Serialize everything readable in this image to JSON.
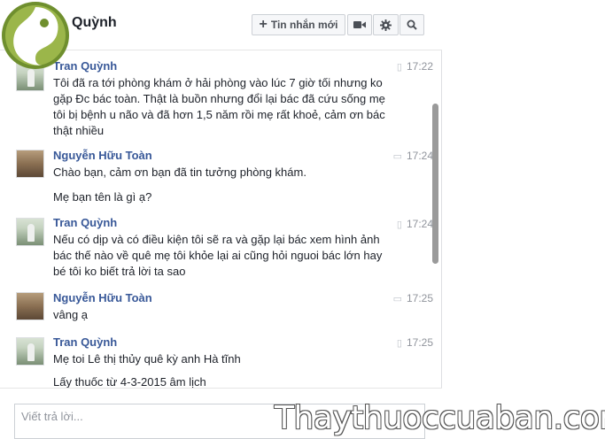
{
  "header": {
    "title": "Quỳnh",
    "new_message_label": "Tin nhắn mới",
    "video_icon": "video-camera-icon",
    "settings_icon": "gear-icon",
    "search_icon": "search-icon"
  },
  "messages": [
    {
      "sender": "Tran Quỳnh",
      "time": "17:22",
      "via": "mobile-phone-icon",
      "lines": [
        "Tôi đã ra tới phòng khám ở hải phòng vào lúc 7 giờ tối nhưng ko gặp Đc bác toàn. Thật là buồn nhưng đổi lại bác đã cứu sống mẹ tôi bị bệnh u não và đã hơn 1,5 năm rồi mẹ rất khoẻ, cảm ơn bác thật nhiều"
      ]
    },
    {
      "sender": "Nguyễn Hữu Toàn",
      "time": "17:24",
      "via": "chat-bubble-icon",
      "lines": [
        "Chào bạn, cảm ơn bạn đã tin tưởng phòng khám.",
        "Mẹ bạn tên là gì ạ?"
      ]
    },
    {
      "sender": "Tran Quỳnh",
      "time": "17:24",
      "via": "mobile-phone-icon",
      "lines": [
        "Nếu có dịp và có điều kiện tôi sẽ ra và gặp lại bác xem hình ảnh bác thế nào về quê mẹ tôi khỏe lại ai cũng hỏi nguoi bác lớn hay bé tôi ko biết trả lời ta sao"
      ]
    },
    {
      "sender": "Nguyễn Hữu Toàn",
      "time": "17:25",
      "via": "chat-bubble-icon",
      "lines": [
        "vâng ạ"
      ]
    },
    {
      "sender": "Tran Quỳnh",
      "time": "17:25",
      "via": "mobile-phone-icon",
      "lines": [
        "Mẹ toi Lê thị thủy quê kỳ anh Hà tĩnh",
        "Lấy thuốc từ 4-3-2015 âm lịch"
      ]
    }
  ],
  "reply": {
    "placeholder": "Viết trả lời..."
  },
  "watermark": "Thaythuoccuaban.com"
}
